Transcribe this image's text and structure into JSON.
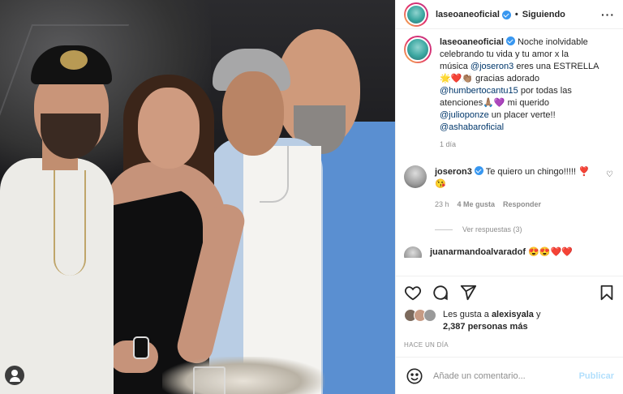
{
  "post": {
    "username": "laseoaneoficial",
    "separator": "•",
    "follow_status": "Siguiendo",
    "more_icon": "more-horizontal-icon"
  },
  "caption": {
    "username": "laseoaneoficial",
    "text_1": "Noche inolvidable celebrando tu vida y tu amor x la música ",
    "mention_1": "@joseron3",
    "text_2": " eres una ESTRELLA 🌟❤️👏🏽 gracias adorado ",
    "mention_2": "@humbertocantu15",
    "text_3": " por todas las atenciones🙏🏽💜 mi querido ",
    "mention_3": "@julioponze",
    "text_4": " un placer verte!! ",
    "mention_4": "@ashabaroficial",
    "time": "1 día"
  },
  "comments": [
    {
      "username": "joseron3",
      "text": "Te quiero un chingo!!!!! ❣️😘",
      "time": "23 h",
      "likes": "4 Me gusta",
      "reply": "Responder",
      "view_replies": "Ver respuestas (3)"
    },
    {
      "username": "juanarmandoalvaradof",
      "text": "😍😍❤️❤️"
    }
  ],
  "actions": {
    "like_icon": "heart-icon",
    "comment_icon": "comment-icon",
    "share_icon": "share-icon",
    "save_icon": "bookmark-icon"
  },
  "likes": {
    "prefix": "Les gusta a ",
    "user": "alexisyala",
    "mid": " y",
    "count": "2,387 personas más"
  },
  "date": "HACE UN DÍA",
  "add_comment": {
    "emoji_icon": "emoji-icon",
    "placeholder": "Añade un comentario...",
    "publish": "Publicar"
  },
  "colors": {
    "link": "#00376b",
    "verified": "#3897f0",
    "publish_disabled": "#b2dffc"
  }
}
